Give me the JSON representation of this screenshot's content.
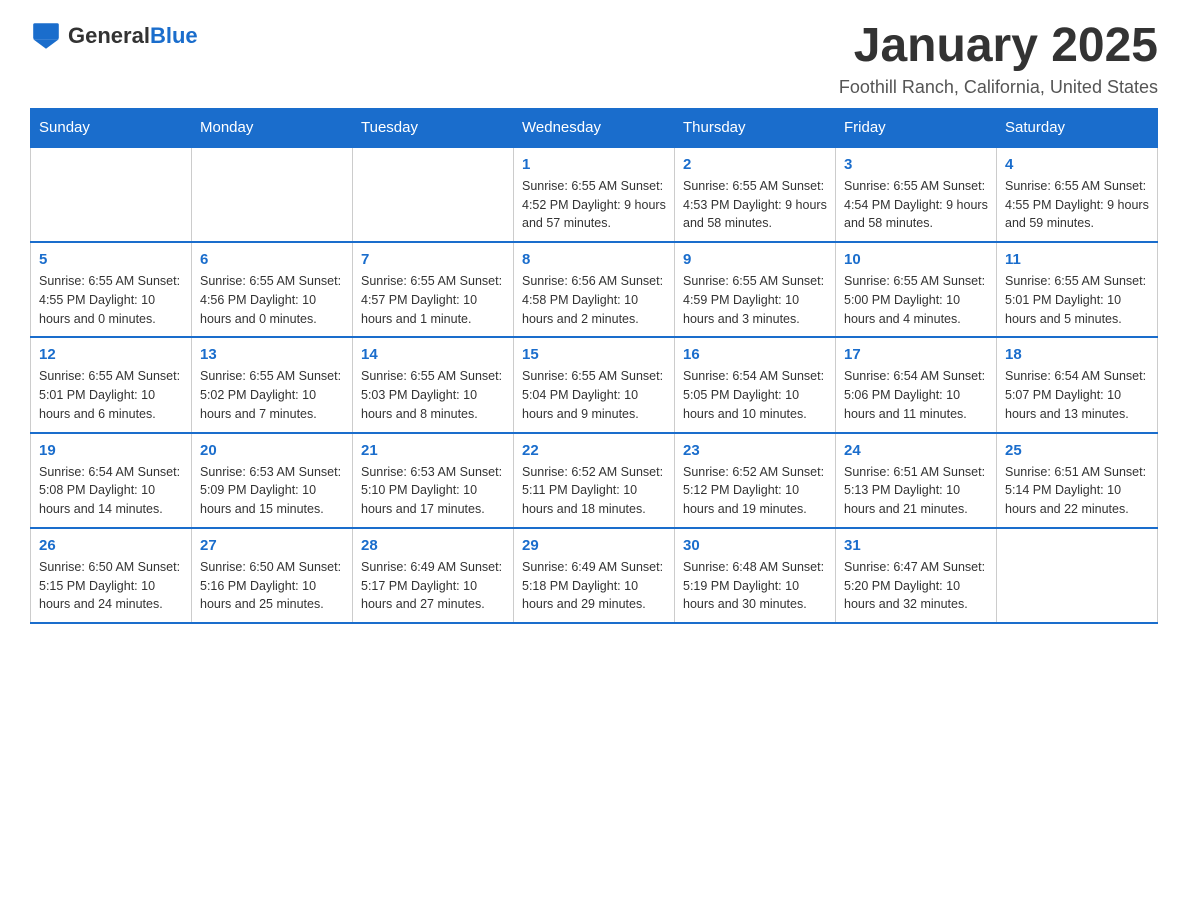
{
  "logo": {
    "general": "General",
    "blue": "Blue"
  },
  "header": {
    "title": "January 2025",
    "location": "Foothill Ranch, California, United States"
  },
  "weekdays": [
    "Sunday",
    "Monday",
    "Tuesday",
    "Wednesday",
    "Thursday",
    "Friday",
    "Saturday"
  ],
  "weeks": [
    [
      {
        "day": "",
        "info": ""
      },
      {
        "day": "",
        "info": ""
      },
      {
        "day": "",
        "info": ""
      },
      {
        "day": "1",
        "info": "Sunrise: 6:55 AM\nSunset: 4:52 PM\nDaylight: 9 hours\nand 57 minutes."
      },
      {
        "day": "2",
        "info": "Sunrise: 6:55 AM\nSunset: 4:53 PM\nDaylight: 9 hours\nand 58 minutes."
      },
      {
        "day": "3",
        "info": "Sunrise: 6:55 AM\nSunset: 4:54 PM\nDaylight: 9 hours\nand 58 minutes."
      },
      {
        "day": "4",
        "info": "Sunrise: 6:55 AM\nSunset: 4:55 PM\nDaylight: 9 hours\nand 59 minutes."
      }
    ],
    [
      {
        "day": "5",
        "info": "Sunrise: 6:55 AM\nSunset: 4:55 PM\nDaylight: 10 hours\nand 0 minutes."
      },
      {
        "day": "6",
        "info": "Sunrise: 6:55 AM\nSunset: 4:56 PM\nDaylight: 10 hours\nand 0 minutes."
      },
      {
        "day": "7",
        "info": "Sunrise: 6:55 AM\nSunset: 4:57 PM\nDaylight: 10 hours\nand 1 minute."
      },
      {
        "day": "8",
        "info": "Sunrise: 6:56 AM\nSunset: 4:58 PM\nDaylight: 10 hours\nand 2 minutes."
      },
      {
        "day": "9",
        "info": "Sunrise: 6:55 AM\nSunset: 4:59 PM\nDaylight: 10 hours\nand 3 minutes."
      },
      {
        "day": "10",
        "info": "Sunrise: 6:55 AM\nSunset: 5:00 PM\nDaylight: 10 hours\nand 4 minutes."
      },
      {
        "day": "11",
        "info": "Sunrise: 6:55 AM\nSunset: 5:01 PM\nDaylight: 10 hours\nand 5 minutes."
      }
    ],
    [
      {
        "day": "12",
        "info": "Sunrise: 6:55 AM\nSunset: 5:01 PM\nDaylight: 10 hours\nand 6 minutes."
      },
      {
        "day": "13",
        "info": "Sunrise: 6:55 AM\nSunset: 5:02 PM\nDaylight: 10 hours\nand 7 minutes."
      },
      {
        "day": "14",
        "info": "Sunrise: 6:55 AM\nSunset: 5:03 PM\nDaylight: 10 hours\nand 8 minutes."
      },
      {
        "day": "15",
        "info": "Sunrise: 6:55 AM\nSunset: 5:04 PM\nDaylight: 10 hours\nand 9 minutes."
      },
      {
        "day": "16",
        "info": "Sunrise: 6:54 AM\nSunset: 5:05 PM\nDaylight: 10 hours\nand 10 minutes."
      },
      {
        "day": "17",
        "info": "Sunrise: 6:54 AM\nSunset: 5:06 PM\nDaylight: 10 hours\nand 11 minutes."
      },
      {
        "day": "18",
        "info": "Sunrise: 6:54 AM\nSunset: 5:07 PM\nDaylight: 10 hours\nand 13 minutes."
      }
    ],
    [
      {
        "day": "19",
        "info": "Sunrise: 6:54 AM\nSunset: 5:08 PM\nDaylight: 10 hours\nand 14 minutes."
      },
      {
        "day": "20",
        "info": "Sunrise: 6:53 AM\nSunset: 5:09 PM\nDaylight: 10 hours\nand 15 minutes."
      },
      {
        "day": "21",
        "info": "Sunrise: 6:53 AM\nSunset: 5:10 PM\nDaylight: 10 hours\nand 17 minutes."
      },
      {
        "day": "22",
        "info": "Sunrise: 6:52 AM\nSunset: 5:11 PM\nDaylight: 10 hours\nand 18 minutes."
      },
      {
        "day": "23",
        "info": "Sunrise: 6:52 AM\nSunset: 5:12 PM\nDaylight: 10 hours\nand 19 minutes."
      },
      {
        "day": "24",
        "info": "Sunrise: 6:51 AM\nSunset: 5:13 PM\nDaylight: 10 hours\nand 21 minutes."
      },
      {
        "day": "25",
        "info": "Sunrise: 6:51 AM\nSunset: 5:14 PM\nDaylight: 10 hours\nand 22 minutes."
      }
    ],
    [
      {
        "day": "26",
        "info": "Sunrise: 6:50 AM\nSunset: 5:15 PM\nDaylight: 10 hours\nand 24 minutes."
      },
      {
        "day": "27",
        "info": "Sunrise: 6:50 AM\nSunset: 5:16 PM\nDaylight: 10 hours\nand 25 minutes."
      },
      {
        "day": "28",
        "info": "Sunrise: 6:49 AM\nSunset: 5:17 PM\nDaylight: 10 hours\nand 27 minutes."
      },
      {
        "day": "29",
        "info": "Sunrise: 6:49 AM\nSunset: 5:18 PM\nDaylight: 10 hours\nand 29 minutes."
      },
      {
        "day": "30",
        "info": "Sunrise: 6:48 AM\nSunset: 5:19 PM\nDaylight: 10 hours\nand 30 minutes."
      },
      {
        "day": "31",
        "info": "Sunrise: 6:47 AM\nSunset: 5:20 PM\nDaylight: 10 hours\nand 32 minutes."
      },
      {
        "day": "",
        "info": ""
      }
    ]
  ]
}
